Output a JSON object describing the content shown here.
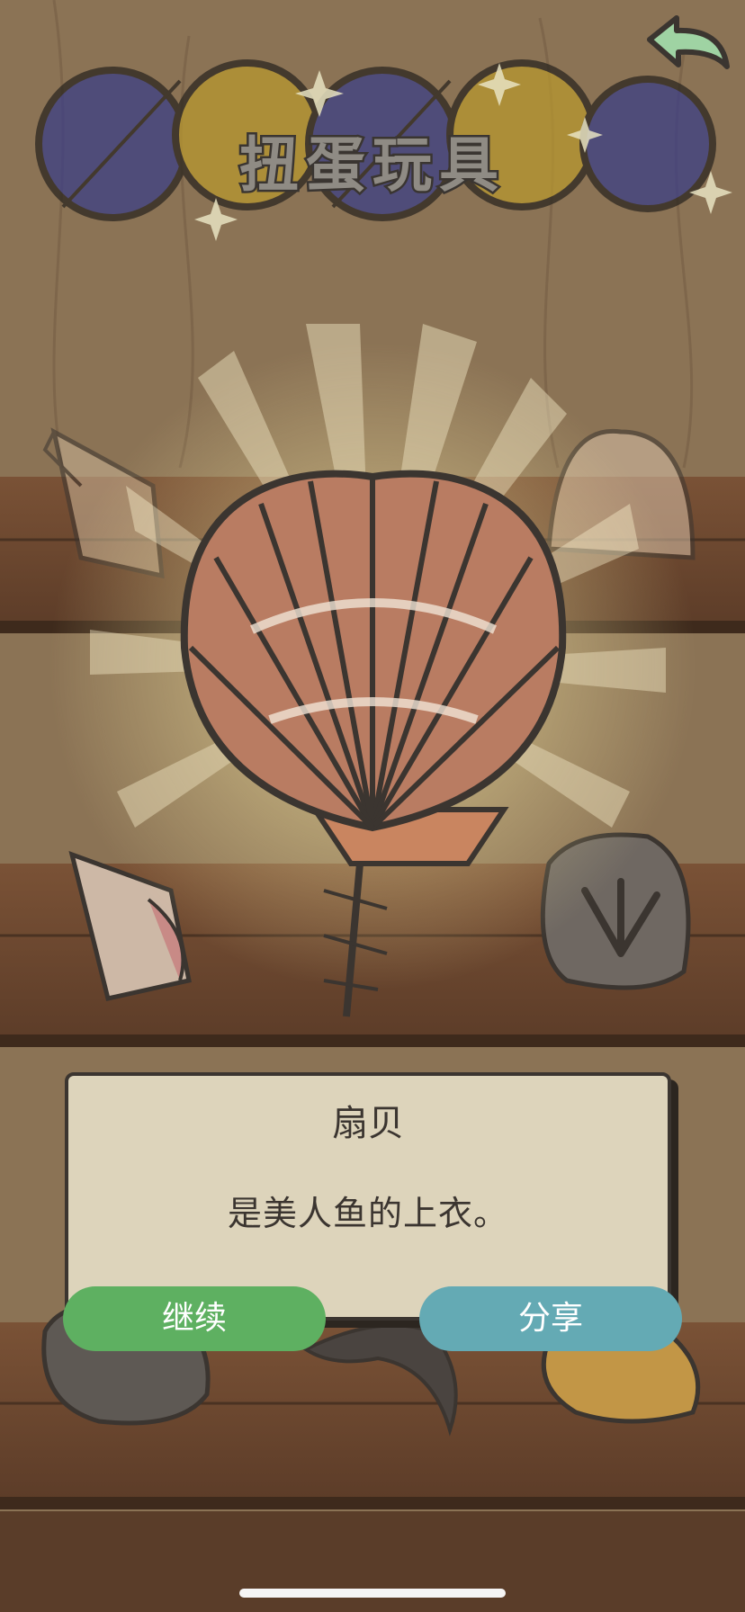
{
  "header": {
    "title": "扭蛋玩具"
  },
  "nav": {
    "back_icon": "back-arrow-icon"
  },
  "item_card": {
    "name": "扇贝",
    "description": "是美人鱼的上衣。"
  },
  "buttons": {
    "continue_label": "继续",
    "share_label": "分享"
  },
  "colors": {
    "continue": "#5eb061",
    "share": "#64aab4",
    "card": "#ddd4bb",
    "shelf": "#6a4630",
    "wall": "#8b7355"
  }
}
